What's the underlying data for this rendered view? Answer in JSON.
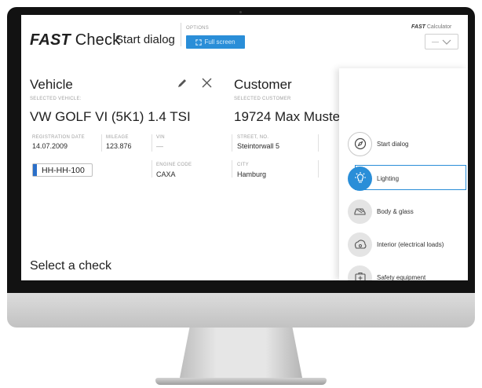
{
  "app": {
    "logo_fast": "FAST",
    "logo_check": "Check",
    "dialog_title": "Start dialog",
    "options_label": "OPTIONS",
    "fullscreen_label": "Full screen",
    "calc_fast": "FAST",
    "calc_label": "Calculator",
    "calc_value": "—",
    "accent_color": "#2a8ed8"
  },
  "vehicle": {
    "heading": "Vehicle",
    "selected_label": "SELECTED VEHICLE:",
    "name": "VW GOLF VI (5K1) 1.4 TSI",
    "fields": {
      "registration_label": "REGISTRATION DATE",
      "registration_value": "14.07.2009",
      "mileage_label": "MILEAGE",
      "mileage_value": "123.876",
      "vin_label": "VIN",
      "vin_value": "—",
      "engine_label": "ENGINE CODE",
      "engine_value": "CAXA"
    },
    "plate": "HH-HH-100"
  },
  "customer": {
    "heading": "Customer",
    "selected_label": "SELECTED CUSTOMER",
    "id_name": "19724   Max Muste",
    "street_label": "STREET, NO.",
    "street_value": "Steintorwall 5",
    "city_label": "CITY",
    "city_value": "Hamburg"
  },
  "checks": {
    "heading": "Select a check"
  },
  "menu": {
    "items": [
      {
        "label": "Start dialog",
        "icon": "compass-icon"
      },
      {
        "label": "Lighting",
        "icon": "bulb-icon",
        "active": true
      },
      {
        "label": "Body & glass",
        "icon": "car-glass-icon"
      },
      {
        "label": "Interior (electrical loads)",
        "icon": "interior-icon"
      },
      {
        "label": "Safety equipment",
        "icon": "first-aid-icon"
      }
    ]
  }
}
